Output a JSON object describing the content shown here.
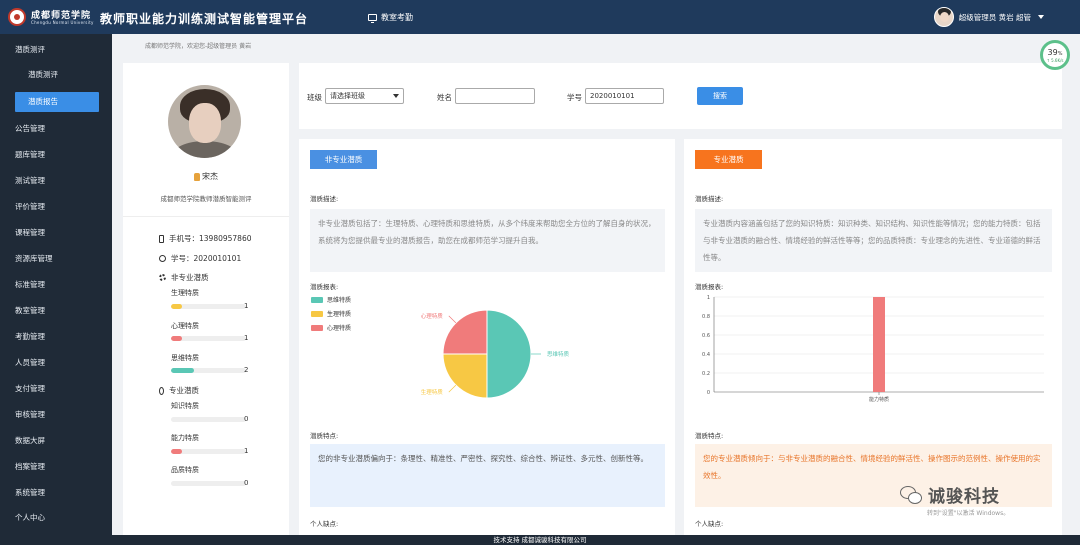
{
  "header": {
    "school_name": "成都师范学院",
    "school_name_en": "Chengdu Normal University",
    "platform_title": "教师职业能力训练测试智能管理平台",
    "nav_item": "教室考勤",
    "user_label": "超级管理员 黄岩 超管"
  },
  "sidebar": {
    "items": [
      "潜质测评",
      "潜质测评",
      "潜质报告",
      "公告管理",
      "题库管理",
      "测试管理",
      "评价管理",
      "课程管理",
      "资源库管理",
      "标准管理",
      "教室管理",
      "考勤管理",
      "人员管理",
      "支付管理",
      "审核管理",
      "数据大屏",
      "档案管理",
      "系统管理",
      "个人中心"
    ]
  },
  "breadcrumb": "成都师范学院，欢迎您-超级管理员 黄岩",
  "profile": {
    "name": "宋杰",
    "org": "成都师范学院教师潜质智能测评",
    "phone": "手机号：13980957860",
    "student_id": "学号：2020010101",
    "nonpro_heading": "非专业潜质",
    "pro_heading": "专业潜质",
    "nonpro_traits": [
      {
        "label": "生理特质",
        "value": "1",
        "fraction": 0.15,
        "color": "#f7c844"
      },
      {
        "label": "心理特质",
        "value": "1",
        "fraction": 0.15,
        "color": "#f07b7b"
      },
      {
        "label": "思维特质",
        "value": "2",
        "fraction": 0.3,
        "color": "#5ac7b5"
      }
    ],
    "pro_traits": [
      {
        "label": "知识特质",
        "value": "0",
        "fraction": 0.0,
        "color": "#f07b7b"
      },
      {
        "label": "能力特质",
        "value": "1",
        "fraction": 0.15,
        "color": "#f07b7b"
      },
      {
        "label": "品质特质",
        "value": "0",
        "fraction": 0.0,
        "color": "#f07b7b"
      }
    ]
  },
  "search": {
    "class_label": "班级",
    "class_value": "请选择班级",
    "name_label": "姓名",
    "name_value": "",
    "id_label": "学号",
    "id_value": "2020010101",
    "button_label": "搜索"
  },
  "nonpro_panel": {
    "tag": "非专业潜质",
    "tag_color": "#4a90e2",
    "desc_label": "潜质描述:",
    "desc_text": "非专业潜质包括了：生理特质、心理特质和思维特质，从多个纬度来帮助您全方位的了解自身的状况，系统将为您提供最专业的潜质报告，助您在成都师范学习提升自我。",
    "report_label": "潜质报表:",
    "feature_label": "潜质特点:",
    "feature_text": "您的非专业潜质偏向于：条理性、精准性、严密性、探究性、综合性、辨证性、多元性、创新性等。",
    "weak_label": "个人缺点:",
    "feature_bg": "#e8f1fd"
  },
  "pro_panel": {
    "tag": "专业潜质",
    "tag_color": "#f7741e",
    "desc_label": "潜质描述:",
    "desc_text": "专业潜质内容涵盖包括了您的知识特质：知识种类、知识结构、知识性能等情况；您的能力特质：包括与非专业潜质的融合性、情境经验的鲜活性等等；您的品质特质：专业理念的先进性、专业道德的鲜活性等。",
    "report_label": "潜质报表:",
    "feature_label": "潜质特点:",
    "feature_text": "您的专业潜质倾向于：与非专业潜质的融合性、情境经验的鲜活性、操作图示的范例性、操作使用的实效性。",
    "weak_label": "个人缺点:",
    "feature_bg": "#fdf1e6",
    "feature_color": "#e8752a"
  },
  "chart_data": [
    {
      "type": "pie",
      "legend": [
        "思维特质",
        "生理特质",
        "心理特质"
      ],
      "values": [
        2,
        1,
        1
      ],
      "colors": [
        "#5ac7b5",
        "#f7c844",
        "#f07b7b"
      ],
      "legend_position": "top-left"
    },
    {
      "type": "bar",
      "categories": [
        "能力特质"
      ],
      "values": [
        1
      ],
      "ylim": [
        0,
        1
      ],
      "yticks": [
        "1",
        "0.8",
        "0.6",
        "0.4",
        "0.2",
        "0"
      ],
      "color": "#f07b7b"
    }
  ],
  "footer": "技术支持 成都诚骏科技有限公司",
  "speed_meter": {
    "percent": "39",
    "percent_sign": "%",
    "rate": "↑ 5.6K/s"
  },
  "watermark": {
    "text": "诚骏科技",
    "activation": "转到\"设置\"以激活 Windows。"
  }
}
